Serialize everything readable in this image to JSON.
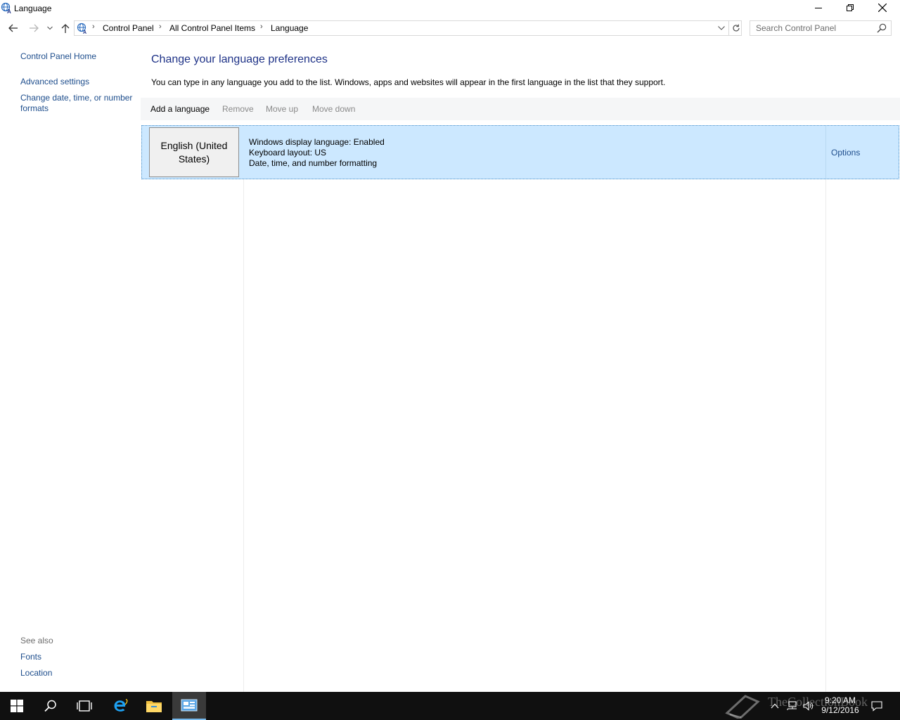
{
  "window": {
    "title": "Language",
    "icon": "language-globe-icon"
  },
  "address_bar": {
    "location_icon": "control-panel-globe-icon",
    "breadcrumbs": [
      "Control Panel",
      "All Control Panel Items",
      "Language"
    ]
  },
  "search": {
    "placeholder": "Search Control Panel"
  },
  "left_pane": {
    "home_link": "Control Panel Home",
    "links": [
      "Advanced settings",
      "Change date, time, or number formats"
    ],
    "see_also_label": "See also",
    "see_also_links": [
      "Fonts",
      "Location"
    ]
  },
  "main": {
    "heading": "Change your language preferences",
    "description": "You can type in any language you add to the list. Windows, apps and websites will appear in the first language in the list that they support.",
    "toolbar": {
      "add": "Add a language",
      "remove": "Remove",
      "move_up": "Move up",
      "move_down": "Move down"
    },
    "languages": [
      {
        "name": "English (United States)",
        "details": [
          "Windows display language: Enabled",
          "Keyboard layout: US",
          "Date, time, and number formatting"
        ],
        "options": "Options"
      }
    ]
  },
  "taskbar": {
    "apps": [
      "start-icon",
      "search-icon",
      "task-view-icon",
      "internet-explorer-icon",
      "file-explorer-icon",
      "control-panel-icon"
    ],
    "active_app": "control-panel-icon",
    "clock_time": "9:20 AM",
    "clock_date": "9/12/2016",
    "watermark": "TheCollectionBook"
  },
  "colors": {
    "link": "#1d4d8c",
    "heading": "#1e3287",
    "selection": "#cce8ff",
    "taskbar": "#101010"
  }
}
